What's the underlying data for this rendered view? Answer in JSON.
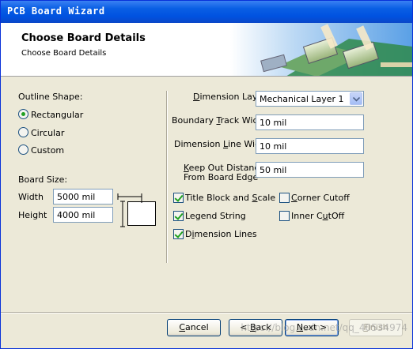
{
  "window": {
    "title": "PCB Board Wizard"
  },
  "header": {
    "title": "Choose Board Details",
    "subtitle": "Choose Board Details"
  },
  "outline": {
    "label": "Outline Shape:",
    "options": [
      {
        "label": "Rectangular",
        "selected": true
      },
      {
        "label": "Circular",
        "selected": false
      },
      {
        "label": "Custom",
        "selected": false
      }
    ]
  },
  "board_size": {
    "label": "Board Size:",
    "width_label": "Width",
    "width_value": "5000 mil",
    "height_label": "Height",
    "height_value": "4000 mil"
  },
  "fields": {
    "dimension_layer_label": "Dimension Layer",
    "dimension_layer_value": "Mechanical Layer 1",
    "boundary_track_width_label": "Boundary Track Width",
    "boundary_track_width_value": "10 mil",
    "dimension_line_width_label": "Dimension Line Width",
    "dimension_line_width_value": "10 mil",
    "keep_out_label_line1": "Keep Out Distance",
    "keep_out_label_line2": "From Board Edge",
    "keep_out_value": "50 mil"
  },
  "options": {
    "title_block_and_scale": {
      "label": "Title Block and Scale",
      "checked": true
    },
    "legend_string": {
      "label": "Legend String",
      "checked": true
    },
    "dimension_lines": {
      "label": "Dimension Lines",
      "checked": true
    },
    "corner_cutoff": {
      "label": "Corner Cutoff",
      "checked": false
    },
    "inner_cutoff": {
      "label": "Inner CutOff",
      "checked": false
    }
  },
  "buttons": {
    "cancel": "Cancel",
    "back": "< Back",
    "next": "Next >",
    "finish": "Finish"
  },
  "watermark": "https://blog.csdn.net/qq_40534974",
  "colors": {
    "titlebar": "#0a5fe4",
    "check_mark": "#21a121"
  }
}
